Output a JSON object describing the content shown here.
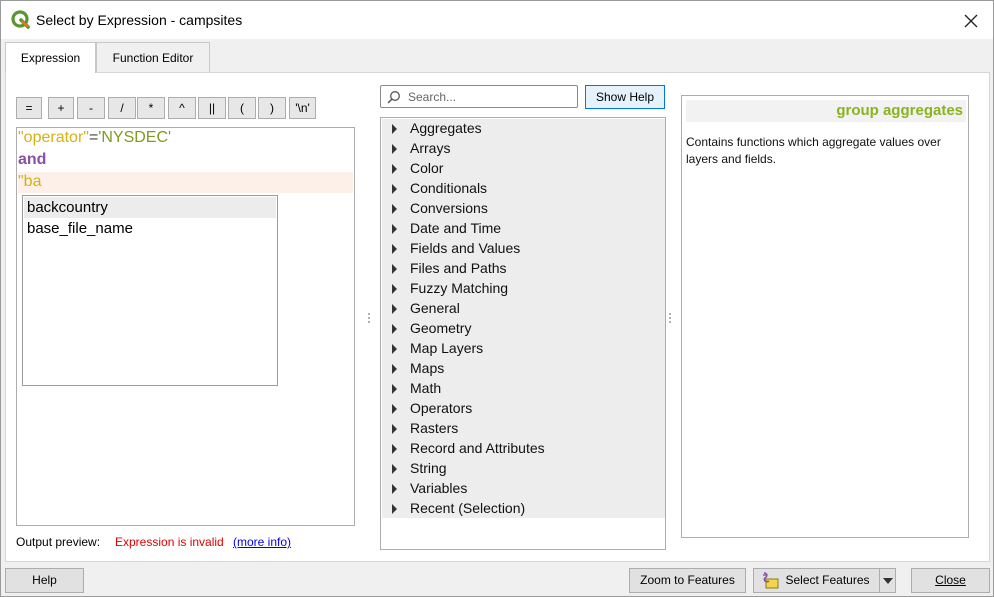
{
  "window": {
    "title": "Select by Expression - campsites"
  },
  "tabs": [
    {
      "label": "Expression"
    },
    {
      "label": "Function Editor"
    }
  ],
  "operators": [
    "=",
    "+",
    "-",
    "/",
    "*",
    "^",
    "||",
    "(",
    ")",
    "'\\n'"
  ],
  "editor": {
    "line1": {
      "field": "\"operator\"",
      "op": "=",
      "value": "'NYSDEC'"
    },
    "line2": {
      "keyword": "and"
    },
    "line3": {
      "partial": "\"ba"
    },
    "autocomplete": [
      "backcountry",
      "base_file_name"
    ]
  },
  "output": {
    "label": "Output preview:",
    "error": "Expression is invalid",
    "link": "(more info)"
  },
  "search": {
    "placeholder": "Search...",
    "value": ""
  },
  "show_help_label": "Show Help",
  "function_groups": [
    "Aggregates",
    "Arrays",
    "Color",
    "Conditionals",
    "Conversions",
    "Date and Time",
    "Fields and Values",
    "Files and Paths",
    "Fuzzy Matching",
    "General",
    "Geometry",
    "Map Layers",
    "Maps",
    "Math",
    "Operators",
    "Rasters",
    "Record and Attributes",
    "String",
    "Variables",
    "Recent (Selection)"
  ],
  "help": {
    "title": "group aggregates",
    "description": "Contains functions which aggregate values over layers and fields."
  },
  "buttons": {
    "help": "Help",
    "zoom": "Zoom to Features",
    "select": "Select Features",
    "close": "Close"
  },
  "colors": {
    "field": "#d6b113",
    "string": "#7f9a1f",
    "keyword": "#8a4fa7",
    "error": "#e00000",
    "help_title": "#8ab31f",
    "accent": "#0078d7"
  }
}
